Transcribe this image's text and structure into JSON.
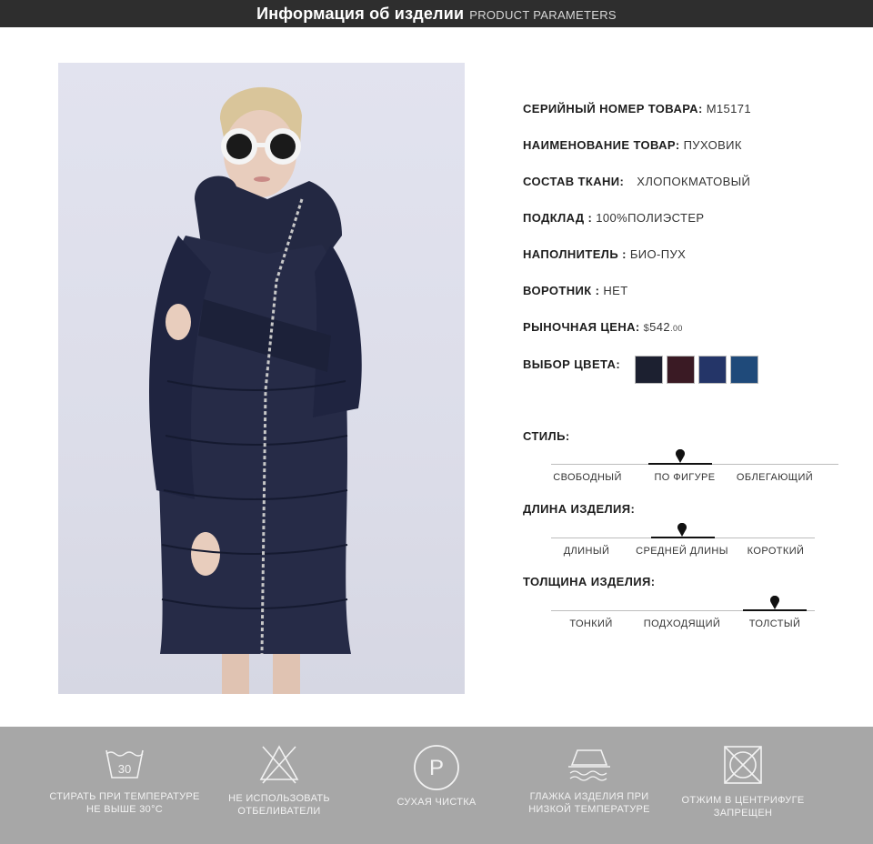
{
  "header": {
    "title_ru": "Информация об изделии",
    "title_en": "PRODUCT PARAMETERS"
  },
  "params": {
    "serial": {
      "label": "СЕРИЙНЫЙ НОМЕР ТОВАРА:",
      "value": "M15171"
    },
    "name": {
      "label": "НАИМЕНОВАНИЕ ТОВАР:",
      "value": "ПУХОВИК"
    },
    "fabric": {
      "label": "СОСТАВ ТКАНИ:",
      "value": "ХЛОПОКМАТОВЫЙ"
    },
    "lining": {
      "label": "ПОДКЛАД :",
      "value": "100%ПОЛИЭСТЕР"
    },
    "filler": {
      "label": "НАПОЛНИТЕЛЬ :",
      "value": "БИО-ПУХ"
    },
    "collar": {
      "label": "ВОРОТНИК :",
      "value": "НЕТ"
    },
    "price": {
      "label": "РЫНОЧНАЯ ЦЕНА:",
      "symbol": "$",
      "amount": "542",
      "cents": ".00"
    },
    "colors": {
      "label": "ВЫБОР ЦВЕТА:",
      "swatches": [
        "#1c2030",
        "#3a1a24",
        "#243568",
        "#1f4a7a"
      ]
    }
  },
  "scales": [
    {
      "title": "СТИЛЬ:",
      "options": [
        "СВОБОДНЫЙ",
        "ПО ФИГУРЕ",
        "ОБЛЕГАЮЩИЙ"
      ],
      "selected_index": 1
    },
    {
      "title": "ДЛИНА ИЗДЕЛИЯ:",
      "options": [
        "ДЛИНЫЙ",
        "СРЕДНЕЙ ДЛИНЫ",
        "КОРОТКИЙ"
      ],
      "selected_index": 1
    },
    {
      "title": "ТОЛЩИНА ИЗДЕЛИЯ:",
      "options": [
        "ТОНКИЙ",
        "ПОДХОДЯЩИЙ",
        "ТОЛСТЫЙ"
      ],
      "selected_index": 2
    }
  ],
  "care": [
    {
      "icon": "wash-30-icon",
      "number": "30",
      "line1": "СТИРАТЬ ПРИ ТЕМПЕРАТУРЕ",
      "line2": "НЕ ВЫШЕ 30°C"
    },
    {
      "icon": "no-bleach-icon",
      "line1": "НЕ ИСПОЛЬЗОВАТЬ",
      "line2": "ОТБЕЛИВАТЕЛИ"
    },
    {
      "icon": "dry-clean-icon",
      "letter": "P",
      "line1": "СУХАЯ ЧИСТКА",
      "line2": ""
    },
    {
      "icon": "iron-low-icon",
      "line1": "ГЛАЖКА ИЗДЕЛИЯ ПРИ",
      "line2": "НИЗКОЙ ТЕМПЕРАТУРЕ"
    },
    {
      "icon": "no-tumble-dry-icon",
      "line1": "ОТЖИМ В ЦЕНТРИФУГЕ",
      "line2": "ЗАПРЕЩЕН"
    }
  ]
}
